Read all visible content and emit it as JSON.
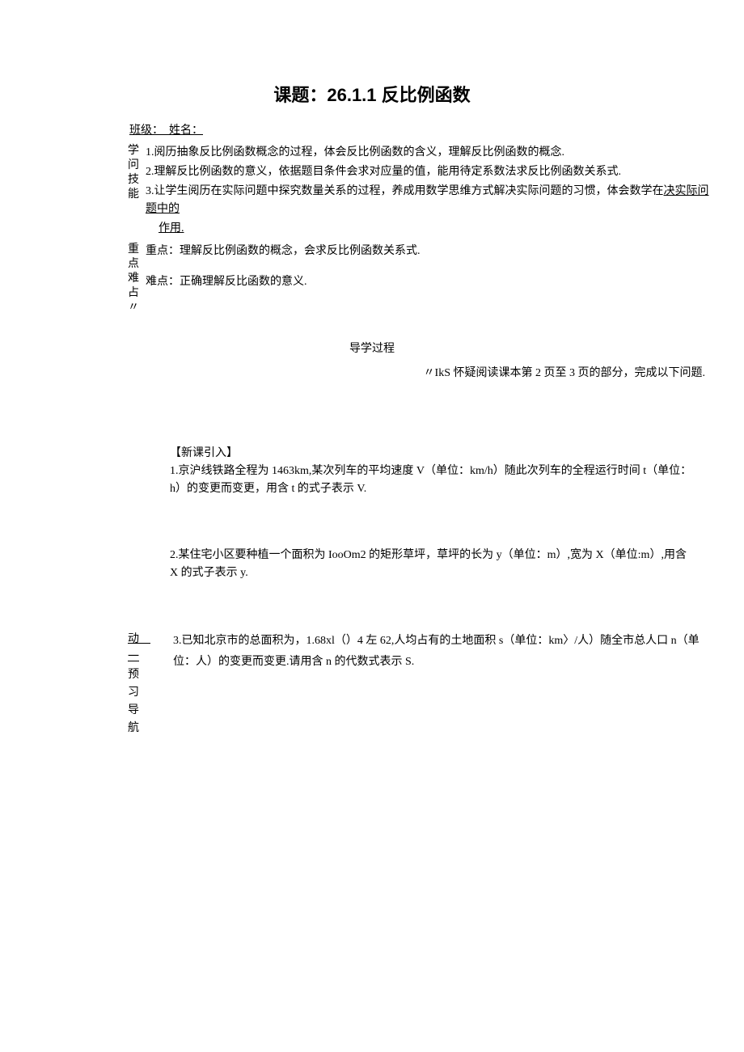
{
  "title": "课题：26.1.1 反比例函数",
  "class_name_line": "班级：　姓名：",
  "skills_label": "学问技能",
  "skills": [
    "1.阅历抽象反比例函数概念的过程，体会反比例函数的含义，理解反比例函数的概念.",
    "2.理解反比例函数的意义，依据题目条件会求对应量的值，能用待定系数法求反比例函数关系式.",
    "3.让学生阅历在实际问题中探究数量关系的过程，养成用数学思维方式解决实际问题的习惯，体会数学在",
    "作用."
  ],
  "skills_underline_tail": "决实际问题中的",
  "focus_label": "重点难点",
  "focus_key": "重点：理解反比例函数的概念，会求反比例函数关系式.",
  "focus_difficult": "难点：正确理解反比函数的意义.",
  "guide_process": "导学过程",
  "pre_read": "〃IkS 怀疑阅读课本第 2 页至 3 页的部分，完成以下问题.",
  "block_heading": "【新课引入】",
  "q1": "1.京沪线铁路全程为 1463km,某次列车的平均速度 V（单位：km/h）随此次列车的全程运行时间 t（单位：h）的变更而变更，用含 t 的式子表示 V.",
  "q2": "2.某住宅小区要种植一个面积为 IooOm2 的矩形草坪，草坪的长为 y（单位：m）,宽为 X（单位:m）,用含 X 的式子表示 y.",
  "nav_label_line1": "动　一",
  "nav_label_line2": "预　习",
  "nav_label_line3": "导　航",
  "q3": "3.已知北京市的总面积为，1.68xl（）4 左 62,人均占有的土地面积 s（单位：km〉/人）随全市总人口 n（单位：人）的变更而变更.请用含 n 的代数式表示 S."
}
